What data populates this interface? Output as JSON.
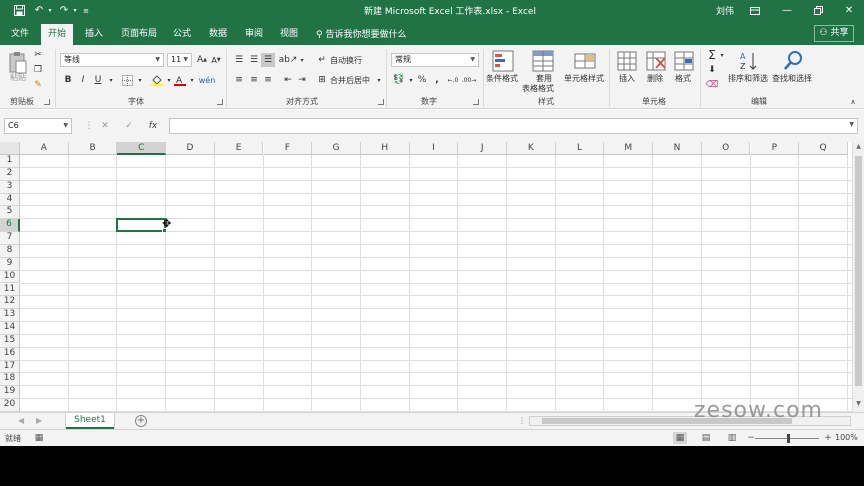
{
  "window": {
    "title": "新建 Microsoft Excel 工作表.xlsx  -  Excel",
    "user": "刘伟"
  },
  "tabs": [
    "文件",
    "开始",
    "插入",
    "页面布局",
    "公式",
    "数据",
    "审阅",
    "视图"
  ],
  "tellme": "告诉我你想要做什么",
  "share_label": "共享",
  "ribbon": {
    "clipboard": {
      "paste": "粘贴",
      "label": "剪贴板"
    },
    "font": {
      "name": "等线",
      "size": "11",
      "label": "字体",
      "bold": "B",
      "italic": "I",
      "underline": "U"
    },
    "alignment": {
      "wrap": "自动换行",
      "merge": "合并后居中",
      "label": "对齐方式"
    },
    "number": {
      "format": "常规",
      "percent": "%",
      "comma": ",",
      "label": "数字"
    },
    "styles": {
      "conditional": "条件格式",
      "table_line1": "套用",
      "table_line2": "表格格式",
      "cell_styles": "单元格样式",
      "label": "样式"
    },
    "cells": {
      "insert": "插入",
      "delete": "删除",
      "format": "格式",
      "label": "单元格"
    },
    "editing": {
      "sort": "排序和筛选",
      "find": "查找和选择",
      "label": "编辑"
    }
  },
  "formula_bar": {
    "name_box": "C6",
    "fx": "fx",
    "cancel": "✕",
    "enter": "✓"
  },
  "grid": {
    "columns": [
      "A",
      "B",
      "C",
      "D",
      "E",
      "F",
      "G",
      "H",
      "I",
      "J",
      "K",
      "L",
      "M",
      "N",
      "O",
      "P",
      "Q"
    ],
    "rows": [
      "1",
      "2",
      "3",
      "4",
      "5",
      "6",
      "7",
      "8",
      "9",
      "10",
      "11",
      "12",
      "13",
      "14",
      "15",
      "16",
      "17",
      "18",
      "19",
      "20"
    ],
    "selected_column": "C",
    "selected_row": "6"
  },
  "sheets": [
    "Sheet1"
  ],
  "status": {
    "ready": "就绪",
    "zoom": "100%"
  },
  "watermark": "zesow.com",
  "colors": {
    "excel_green": "#217346",
    "ribbon_bg": "#f3f3f3"
  }
}
